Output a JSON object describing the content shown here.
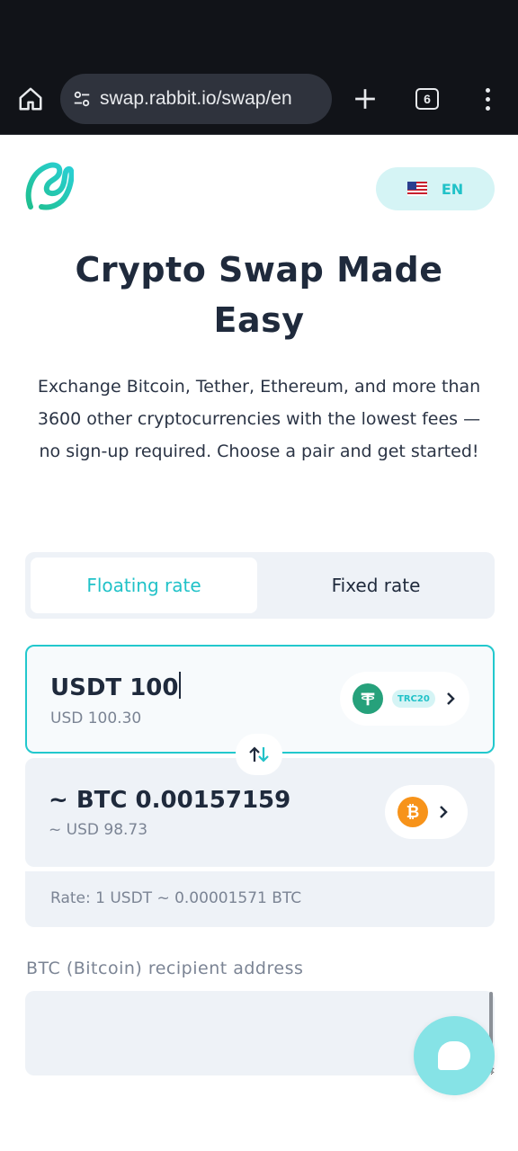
{
  "browser": {
    "url": "swap.rabbit.io/swap/en",
    "tab_count": "6",
    "icons": [
      "home-icon",
      "site-settings-icon",
      "plus-icon",
      "tabs-icon",
      "more-vert-icon"
    ]
  },
  "header": {
    "language": "EN",
    "flag": "us-flag"
  },
  "hero": {
    "title": "Crypto Swap Made Easy",
    "subtitle": "Exchange Bitcoin, Tether, Ethereum, and more than 3600 other cryptocurrencies with the lowest fees — no sign-up required. Choose a pair and get started!"
  },
  "rate_toggle": {
    "floating": "Floating rate",
    "fixed": "Fixed rate",
    "selected": "floating"
  },
  "send": {
    "amount": "USDT 100",
    "usd_value": "USD 100.30",
    "coin": "USDT",
    "network": "TRC20"
  },
  "receive": {
    "amount": "~ BTC 0.00157159",
    "usd_value": "~ USD 98.73",
    "coin": "BTC"
  },
  "rate": {
    "text": "Rate: 1 USDT ~ 0.00001571 BTC"
  },
  "recipient": {
    "label": "BTC (Bitcoin) recipient address",
    "value": ""
  },
  "colors": {
    "accent": "#21c2c8",
    "tether": "#26a17b",
    "bitcoin": "#f7931a",
    "text": "#1f2a3c",
    "muted": "#7b8494",
    "chat": "#86e3e6"
  }
}
